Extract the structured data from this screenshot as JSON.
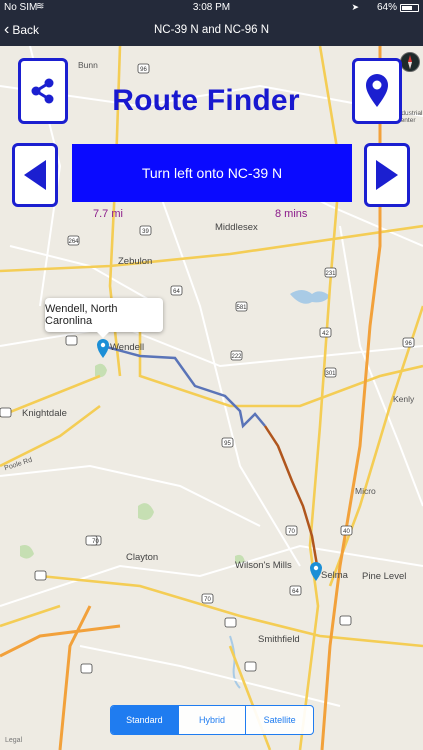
{
  "status_bar": {
    "carrier": "No SIM",
    "time": "3:08 PM",
    "battery": "64%"
  },
  "nav": {
    "back_label": "Back",
    "title": "NC-39 N and NC-96 N"
  },
  "app": {
    "title": "Route Finder",
    "direction": "Turn left onto NC-39 N",
    "distance": "7.7 mi",
    "duration": "8 mins"
  },
  "callout": {
    "text": "Wendell, North Caronlina"
  },
  "map_type": {
    "options": [
      "Standard",
      "Hybrid",
      "Satellite"
    ],
    "selected": "Standard"
  },
  "map": {
    "legal": "Legal",
    "place_labels": [
      "Bunn",
      "Middlesex",
      "Zebulon",
      "Wendell",
      "Knightdale",
      "Clayton",
      "Wilson's Mills",
      "Smithfield",
      "Selma",
      "Pine Level",
      "Micro",
      "Kenly",
      "Industrial Center",
      "Poole Rd"
    ],
    "route_labels": [
      "96",
      "39",
      "264",
      "64",
      "581",
      "231",
      "42",
      "222",
      "301",
      "95",
      "70",
      "40",
      "96",
      "70",
      "70",
      "64"
    ]
  },
  "colors": {
    "accent": "#1b1fd0",
    "banner": "#0a0aff",
    "route": "#5a74b8",
    "route_traffic": "#b0561e",
    "segment": "#1f7cf0"
  }
}
